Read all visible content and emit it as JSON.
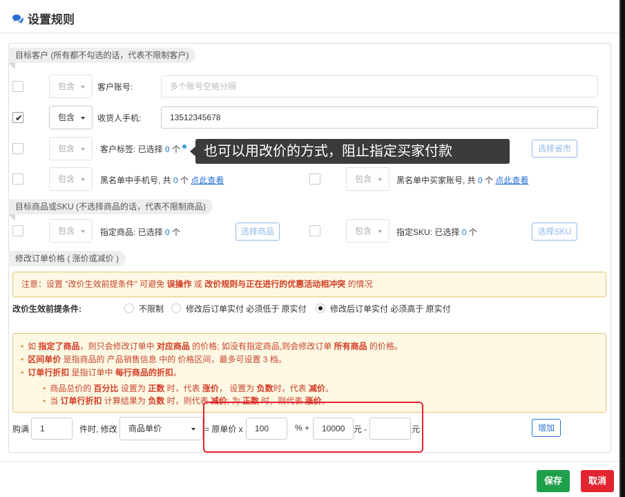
{
  "dialog": {
    "title": "设置规则"
  },
  "sections": {
    "target_customer": "目标客户 (所有都不勾选的话，代表不限制客户)",
    "target_goods": "目标商品或SKU (不选择商品的话，代表不限制商品)",
    "modify_price": "修改订单价格 ( 涨价或减价 )"
  },
  "customer": {
    "account": {
      "include": "包含",
      "label": "客户账号:",
      "placeholder": "多个账号空格分隔",
      "checked": false
    },
    "phone": {
      "include": "包含",
      "label": "收货人手机:",
      "value": "13512345678",
      "checked": true
    },
    "tags": {
      "include": "包含",
      "label_prefix": "客户标签: 已选择",
      "count": "0",
      "unit": "个",
      "checked": false
    },
    "province_button": "选择省市",
    "phone_blacklist": {
      "include": "包含",
      "label_prefix": "黑名单中手机号, 共",
      "count": "0",
      "unit": "个",
      "link": "点此查看",
      "checked": false
    },
    "buyer_blacklist": {
      "include": "包含",
      "label_prefix": "黑名单中买家账号, 共",
      "count": "0",
      "unit": "个",
      "link": "点此查看",
      "checked": false
    }
  },
  "goods": {
    "product": {
      "include": "包含",
      "label_prefix": "指定商品: 已选择",
      "count": "0",
      "unit": "个",
      "button": "选择商品",
      "checked": false
    },
    "sku": {
      "include": "包含",
      "label_prefix": "指定SKU: 已选择",
      "count": "0",
      "unit": "个",
      "button": "选择SKU",
      "checked": false
    }
  },
  "tooltip": "也可以用改价的方式，阻止指定买家付款",
  "notice": {
    "p1": "注意：设置 \"改价生效前提条件\" 可避免 ",
    "b1": "误操作",
    "p2": " 或 ",
    "b2": "改价规则与正在进行的优惠活动相冲突",
    "p3": " 的情况"
  },
  "precondition": {
    "label": "改价生效前提条件:",
    "options": [
      "不限制",
      "修改后订单实付 必须低于 原实付",
      "修改后订单实付 必须高于 原实付"
    ],
    "selected_index": 2
  },
  "help": {
    "l1": {
      "a": "如 ",
      "b1": "指定了商品",
      "c": "，则只会修改订单中 ",
      "b2": "对应商品",
      "d": " 的价格; 如没有指定商品,则会修改订单 ",
      "b3": "所有商品",
      "e": " 的价格。"
    },
    "l2": {
      "b1": "区间单价",
      "a": " 是指商品的 产品销售信息 中的 价格区间，最多可设置 3 档。"
    },
    "l3": {
      "b1": "订单行折扣",
      "a": " 是指订单中 ",
      "b2": "每行商品的折扣",
      "c": "。"
    },
    "l4": {
      "a": "商品总价的 ",
      "b1": "百分比",
      "c": " 设置为 ",
      "b2": "正数",
      "d": " 时，代表 ",
      "b3": "涨价",
      "e": "， 设置为 ",
      "b4": "负数",
      "f": "时，代表 ",
      "b5": "减价",
      "g": "。"
    },
    "l5": {
      "a": "当 ",
      "b1": "订单行折扣",
      "c": " 计算结果为 ",
      "b2": "负数",
      "d": " 时，则代表 ",
      "b3": "减价",
      "e": "; 为 ",
      "b4": "正数",
      "f": " 时，则代表 ",
      "b5": "涨价",
      "g": "。"
    }
  },
  "formula": {
    "buy_label": "购满",
    "buy_value": "1",
    "piece_label": "件时, 修改",
    "target_select": "商品单价",
    "eq_label": "= 原单价 x",
    "percent_value": "100",
    "percent_label": "% +",
    "add_value": "10000",
    "yuan_minus": "元 -",
    "minus_value": "",
    "yuan": "元",
    "add_button": "增加"
  },
  "footer": {
    "save": "保存",
    "cancel": "取消"
  },
  "colors": {
    "accent_blue": "#2a6fd6",
    "save_green": "#1ea04a",
    "cancel_red": "#e02531",
    "warning_red": "#c7442f"
  }
}
